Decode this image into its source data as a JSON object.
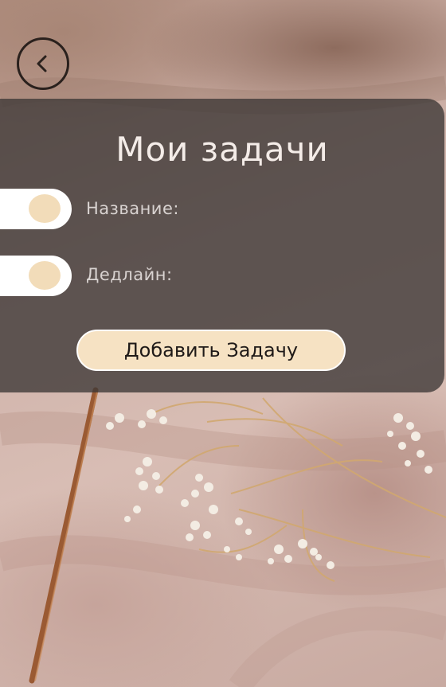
{
  "header": {
    "back_icon": "chevron-left-icon"
  },
  "panel": {
    "title": "Мои задачи",
    "fields": [
      {
        "label": "Название:"
      },
      {
        "label": "Дедлайн:"
      }
    ],
    "add_button_label": "Добавить Задачу"
  },
  "colors": {
    "panel_overlay": "#3c3736",
    "accent": "#f6e2c3",
    "toggle_knob": "#f2dcb9",
    "toggle_track": "#ffffff",
    "title_text": "#f4ece8",
    "label_text": "#d9d3d1"
  }
}
